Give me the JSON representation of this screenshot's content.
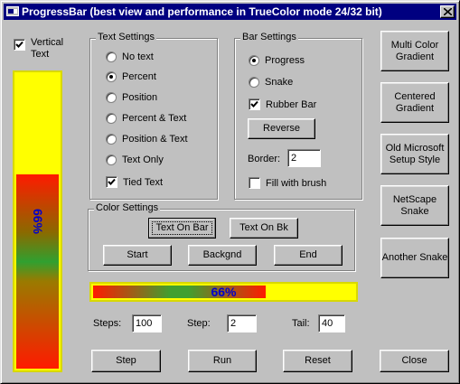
{
  "window": {
    "title": "ProgressBar (best view and performance in TrueColor mode 24/32 bit)"
  },
  "vertical_text": {
    "label": "Vertical Text",
    "checked": true
  },
  "vertical_bar": {
    "text": "66%",
    "percent": 66
  },
  "text_settings": {
    "title": "Text Settings",
    "options": [
      {
        "label": "No text",
        "selected": false
      },
      {
        "label": "Percent",
        "selected": true
      },
      {
        "label": "Position",
        "selected": false
      },
      {
        "label": "Percent & Text",
        "selected": false
      },
      {
        "label": "Position & Text",
        "selected": false
      },
      {
        "label": "Text Only",
        "selected": false
      }
    ],
    "tied_text": {
      "label": "Tied Text",
      "checked": true
    }
  },
  "bar_settings": {
    "title": "Bar Settings",
    "options": [
      {
        "label": "Progress",
        "selected": true
      },
      {
        "label": "Snake",
        "selected": false
      }
    ],
    "rubber_bar": {
      "label": "Rubber Bar",
      "checked": true
    },
    "reverse_label": "Reverse",
    "border_label": "Border:",
    "border_value": "2",
    "fill_with_brush": {
      "label": "Fill with brush",
      "checked": false
    }
  },
  "color_settings": {
    "title": "Color Settings",
    "text_on_bar": "Text On Bar",
    "text_on_bk": "Text On Bk",
    "start": "Start",
    "backgnd": "Backgnd",
    "end": "End"
  },
  "horizontal_bar": {
    "text": "66%",
    "percent": 66
  },
  "steps": {
    "label": "Steps:",
    "value": "100"
  },
  "step": {
    "label": "Step:",
    "value": "2"
  },
  "tail": {
    "label": "Tail:",
    "value": "40"
  },
  "buttons": {
    "step": "Step",
    "run": "Run",
    "reset": "Reset",
    "close": "Close"
  },
  "style_buttons": [
    "Multi Color Gradient",
    "Centered Gradient",
    "Old Microsoft Setup Style",
    "NetScape Snake",
    "Another Snake"
  ],
  "colors": {
    "titlebar": "#000080",
    "bar_background": "#ffff00",
    "bar_start": "#ff1a00",
    "bar_text": "#0000cc"
  }
}
